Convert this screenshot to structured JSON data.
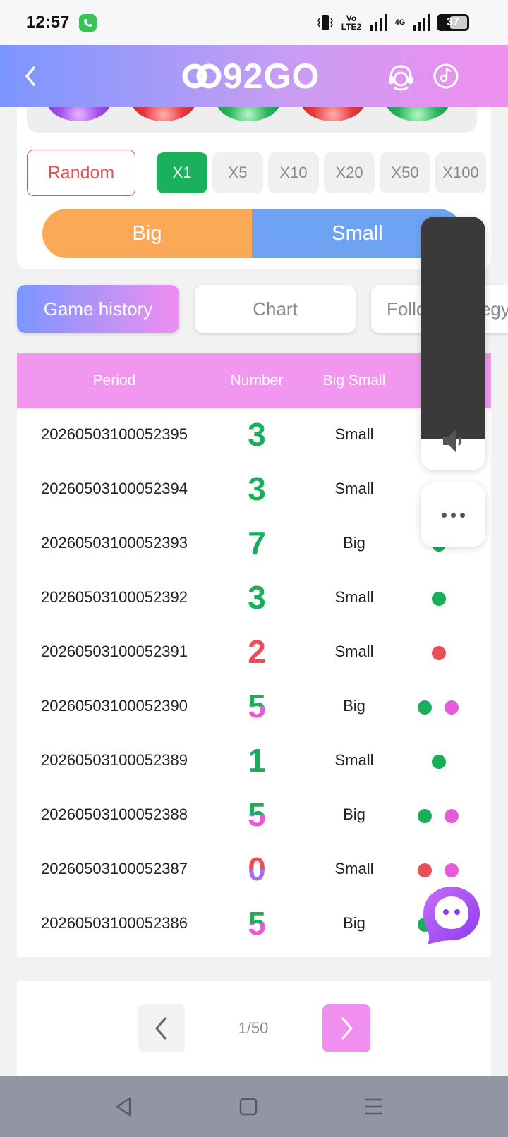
{
  "status_bar": {
    "time": "12:57",
    "network": "Vo LTE2",
    "network_type": "4G",
    "battery": "37"
  },
  "header": {
    "logo_text": "92GO",
    "icons": [
      "back-icon",
      "support-agent-icon",
      "music-icon"
    ]
  },
  "bet_panel": {
    "random_label": "Random",
    "multipliers": [
      "X1",
      "X5",
      "X10",
      "X20",
      "X50",
      "X100"
    ],
    "active_multiplier": "X1",
    "big_label": "Big",
    "small_label": "Small"
  },
  "tabs": {
    "game_history": "Game history",
    "chart": "Chart",
    "follow_strategy": "Follow strategy"
  },
  "table": {
    "headers": {
      "period": "Period",
      "number": "Number",
      "big_small": "Big Small"
    },
    "rows": [
      {
        "period": "20260503100052395",
        "number": "3",
        "big_small": "Small",
        "colors": [
          "green"
        ]
      },
      {
        "period": "20260503100052394",
        "number": "3",
        "big_small": "Small",
        "colors": [
          "green"
        ]
      },
      {
        "period": "20260503100052393",
        "number": "7",
        "big_small": "Big",
        "colors": [
          "green"
        ]
      },
      {
        "period": "20260503100052392",
        "number": "3",
        "big_small": "Small",
        "colors": [
          "green"
        ]
      },
      {
        "period": "20260503100052391",
        "number": "2",
        "big_small": "Small",
        "colors": [
          "red"
        ]
      },
      {
        "period": "20260503100052390",
        "number": "5",
        "big_small": "Big",
        "colors": [
          "green",
          "violet"
        ]
      },
      {
        "period": "20260503100052389",
        "number": "1",
        "big_small": "Small",
        "colors": [
          "green"
        ]
      },
      {
        "period": "20260503100052388",
        "number": "5",
        "big_small": "Big",
        "colors": [
          "green",
          "violet"
        ]
      },
      {
        "period": "20260503100052387",
        "number": "0",
        "big_small": "Small",
        "colors": [
          "red",
          "violet"
        ]
      },
      {
        "period": "20260503100052386",
        "number": "5",
        "big_small": "Big",
        "colors": [
          "green",
          "violet"
        ]
      }
    ]
  },
  "pagination": {
    "label": "1/50"
  },
  "colors": {
    "green": "#18ae5a",
    "red": "#e84f56",
    "violet": "#e55bd8",
    "pink_header": "#f197ef",
    "big": "#fba956",
    "small": "#6ea3f3"
  }
}
